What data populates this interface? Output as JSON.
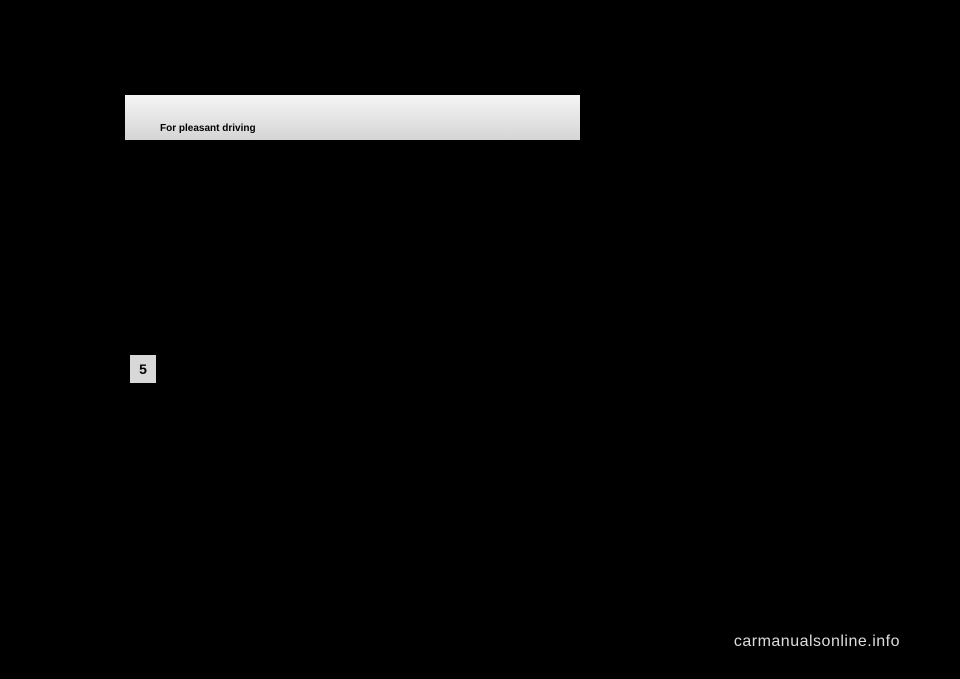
{
  "header": {
    "title": "For pleasant driving"
  },
  "section": {
    "number": "5"
  },
  "watermark": {
    "text": "carmanualsonline.info"
  }
}
